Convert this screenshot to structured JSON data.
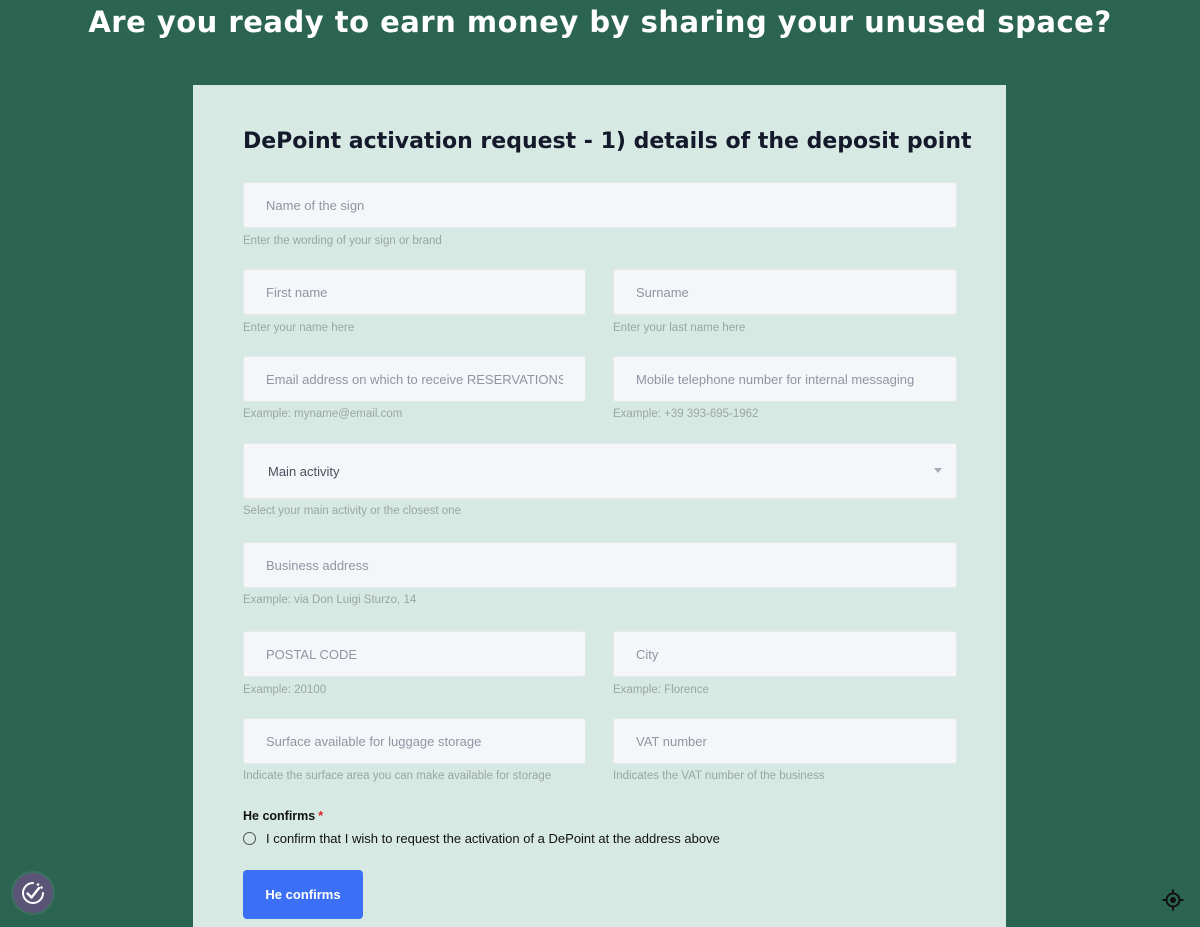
{
  "page": {
    "title": "Are you ready to earn money by sharing your unused space?"
  },
  "form": {
    "title": "DePoint activation request - 1) details of the deposit point",
    "sign": {
      "placeholder": "Name of the sign",
      "hint": "Enter the wording of your sign or brand"
    },
    "first_name": {
      "placeholder": "First name",
      "hint": "Enter your name here"
    },
    "surname": {
      "placeholder": "Surname",
      "hint": "Enter your last name here"
    },
    "email": {
      "placeholder": "Email address on which to receive RESERVATIONS",
      "hint": "Example: myname@email.com"
    },
    "mobile": {
      "placeholder": "Mobile telephone number for internal messaging",
      "hint": "Example: +39 393-695-1962"
    },
    "main_activity": {
      "value": "Main activity",
      "hint": "Select your main activity or the closest one"
    },
    "business_address": {
      "placeholder": "Business address",
      "hint": "Example: via Don Luigi Sturzo, 14"
    },
    "postal_code": {
      "placeholder": "POSTAL CODE",
      "hint": "Example: 20100"
    },
    "city": {
      "placeholder": "City",
      "hint": "Example: Florence"
    },
    "surface": {
      "placeholder": "Surface available for luggage storage",
      "hint": "Indicate the surface area you can make available for storage"
    },
    "vat": {
      "placeholder": "VAT number",
      "hint": "Indicates the VAT number of the business"
    },
    "confirm": {
      "label": "He confirms",
      "required_mark": "*",
      "option": "I confirm that I wish to request the activation of a DePoint at the address above"
    },
    "submit_label": "He confirms"
  },
  "colors": {
    "background": "#2b6551",
    "card": "#d6e9e2",
    "button": "#3b6ff5",
    "required": "#e0242b"
  },
  "icons": {
    "left_floating": "accessibility-check-icon",
    "right_floating": "location-target-icon"
  }
}
